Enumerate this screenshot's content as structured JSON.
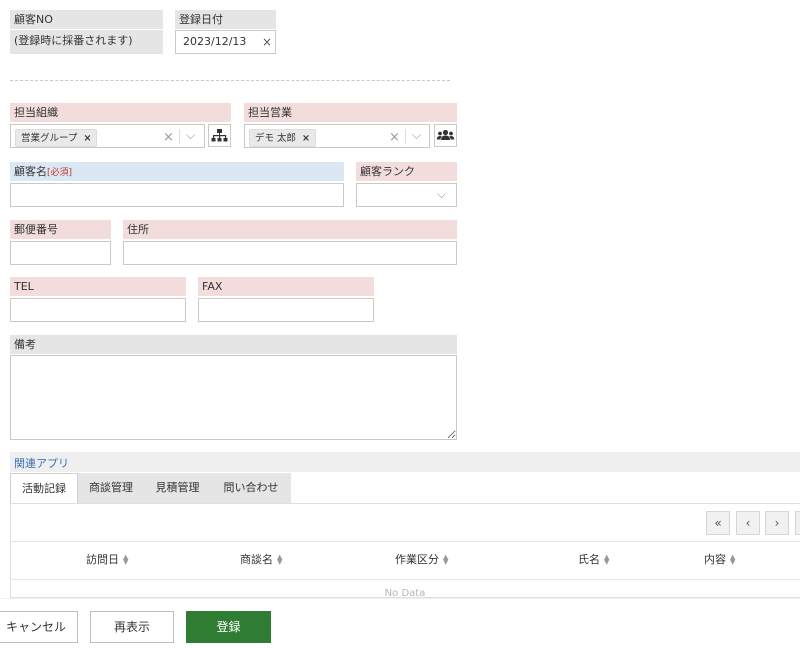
{
  "customer_no": {
    "label": "顧客NO",
    "value": "(登録時に採番されます)"
  },
  "registration_date": {
    "label": "登録日付",
    "value": "2023/12/13",
    "clear": "×"
  },
  "org": {
    "label": "担当組織",
    "tag": "営業グループ",
    "tag_remove": "×",
    "clear": "×",
    "arrow": "⌵"
  },
  "sales": {
    "label": "担当営業",
    "tag": "デモ 太郎",
    "tag_remove": "×",
    "clear": "×",
    "arrow": "⌵"
  },
  "customer_name": {
    "label": "顧客名",
    "required": "[必須]",
    "value": ""
  },
  "customer_rank": {
    "label": "顧客ランク",
    "arrow": "⌵",
    "value": ""
  },
  "postal": {
    "label": "郵便番号",
    "value": ""
  },
  "address": {
    "label": "住所",
    "value": ""
  },
  "tel": {
    "label": "TEL",
    "value": ""
  },
  "fax": {
    "label": "FAX",
    "value": ""
  },
  "memo": {
    "label": "備考",
    "value": ""
  },
  "related": {
    "title": "関連アプリ",
    "tabs": [
      "活動記録",
      "商談管理",
      "見積管理",
      "問い合わせ"
    ],
    "active_tab": 0,
    "pager": [
      "«",
      "‹",
      "›"
    ],
    "columns": [
      "訪問日",
      "商談名",
      "作業区分",
      "氏名",
      "内容"
    ],
    "empty": "No Data"
  },
  "buttons": {
    "cancel": "キャンセル",
    "reload": "再表示",
    "submit": "登録"
  },
  "colors": {
    "primary": "#2e7d32",
    "link": "#3a73b3"
  }
}
